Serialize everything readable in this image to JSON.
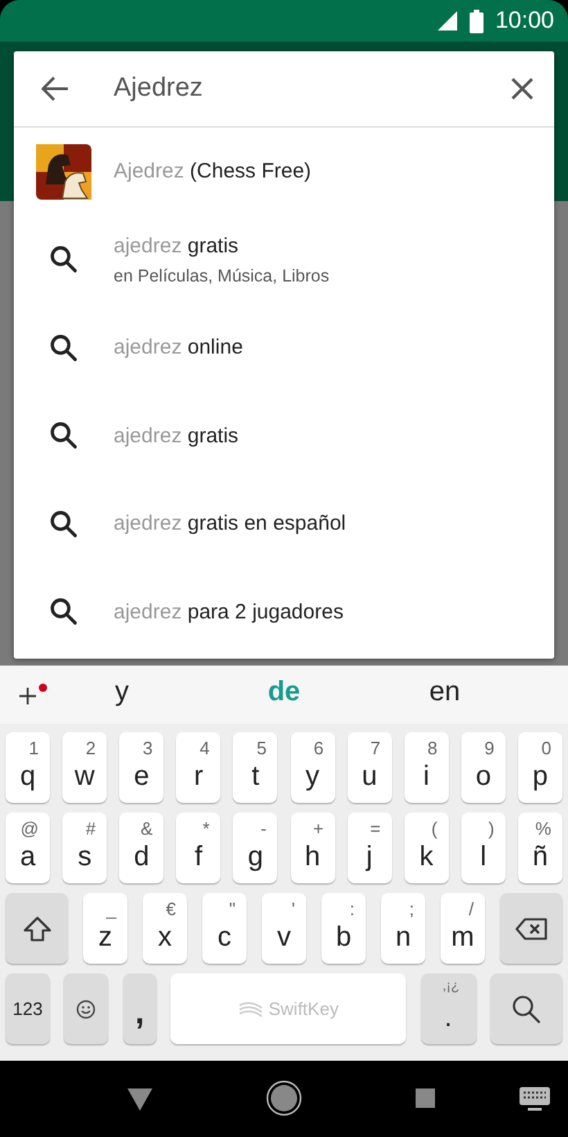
{
  "status_bar": {
    "time": "10:00"
  },
  "search": {
    "value": "Ajedrez"
  },
  "suggestions": [
    {
      "kind": "app",
      "match": "Ajedrez",
      "rest": " (Chess Free)"
    },
    {
      "kind": "query",
      "match": "ajedrez",
      "rest": " gratis",
      "subtitle": "en Películas, Música, Libros"
    },
    {
      "kind": "query",
      "match": "ajedrez",
      "rest": " online"
    },
    {
      "kind": "query",
      "match": "ajedrez",
      "rest": " gratis"
    },
    {
      "kind": "query",
      "match": "ajedrez",
      "rest": " gratis en español"
    },
    {
      "kind": "query",
      "match": "ajedrez",
      "rest": " para 2 jugadores"
    }
  ],
  "keyboard": {
    "predictions": [
      {
        "word": "y",
        "selected": false
      },
      {
        "word": "de",
        "selected": true
      },
      {
        "word": "en",
        "selected": false
      }
    ],
    "rows": [
      {
        "keys": [
          {
            "label": "q",
            "hint": "1"
          },
          {
            "label": "w",
            "hint": "2"
          },
          {
            "label": "e",
            "hint": "3"
          },
          {
            "label": "r",
            "hint": "4"
          },
          {
            "label": "t",
            "hint": "5"
          },
          {
            "label": "y",
            "hint": "6"
          },
          {
            "label": "u",
            "hint": "7"
          },
          {
            "label": "i",
            "hint": "8"
          },
          {
            "label": "o",
            "hint": "9"
          },
          {
            "label": "p",
            "hint": "0"
          }
        ]
      },
      {
        "keys": [
          {
            "label": "a",
            "hint": "@"
          },
          {
            "label": "s",
            "hint": "#"
          },
          {
            "label": "d",
            "hint": "&"
          },
          {
            "label": "f",
            "hint": "*"
          },
          {
            "label": "g",
            "hint": "-"
          },
          {
            "label": "h",
            "hint": "+"
          },
          {
            "label": "j",
            "hint": "="
          },
          {
            "label": "k",
            "hint": "("
          },
          {
            "label": "l",
            "hint": ")"
          },
          {
            "label": "ñ",
            "hint": "%"
          }
        ]
      },
      {
        "keys": [
          {
            "kind": "shift"
          },
          {
            "label": "z",
            "hint": "_"
          },
          {
            "label": "x",
            "hint": "€"
          },
          {
            "label": "c",
            "hint": "\""
          },
          {
            "label": "v",
            "hint": "'"
          },
          {
            "label": "b",
            "hint": ":"
          },
          {
            "label": "n",
            "hint": ";"
          },
          {
            "label": "m",
            "hint": "/"
          },
          {
            "kind": "backspace"
          }
        ]
      },
      {
        "keys": [
          {
            "kind": "numbers",
            "label": "123"
          },
          {
            "kind": "emoji"
          },
          {
            "kind": "comma",
            "label": ","
          },
          {
            "kind": "space",
            "label": "SwiftKey"
          },
          {
            "kind": "period",
            "label": ".",
            "hint": ",¡¿"
          },
          {
            "kind": "search"
          }
        ]
      }
    ]
  }
}
